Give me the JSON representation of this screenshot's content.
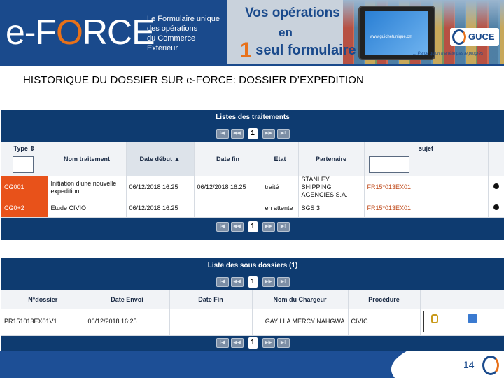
{
  "banner": {
    "logo": "e-FORCE",
    "tagline": [
      "Le Formulaire unique",
      "des opérations",
      "du Commerce Extérieur"
    ],
    "promo_line1": "Vos opérations",
    "promo_line2": "en",
    "promo_big": "1",
    "promo_line3": "seul formulaire",
    "tablet_url": "www.guichetunique.cm",
    "partner": "GUCE",
    "partner_slogan": "... Parce qu'on n'arrête pas le progrès"
  },
  "page_title": "HISTORIQUE DU DOSSIER SUR e-FORCE: DOSSIER D’EXPEDITION",
  "treatments": {
    "title": "Listes des traitements",
    "pager": {
      "first": "I◀",
      "prev": "◀◀",
      "current": "1",
      "next": "▶▶",
      "last": "▶I"
    },
    "columns": [
      "Type",
      "Nom traitement",
      "Date début",
      "Date fin",
      "Etat",
      "Partenaire",
      "sujet"
    ],
    "sort_marker": "▲",
    "type_sort_marker": "⇕",
    "rows": [
      {
        "code": "CG001",
        "name": "Initiation d'une nouvelle expedition",
        "start": "06/12/2018 16:25",
        "end": "06/12/2018 16:25",
        "state": "traité",
        "partner": "STANLEY SHIPPING AGENCIES S.A.",
        "subject": "FR15*013EX01"
      },
      {
        "code": "CG0+2",
        "name": "Etude CIVIO",
        "start": "06/12/2018 16:25",
        "end": "",
        "state": "en attente",
        "partner": "SGS 3",
        "subject": "FR15*013EX01"
      }
    ]
  },
  "sub_files": {
    "title": "Liste des sous dossiers (1)",
    "pager": {
      "first": "I◀",
      "prev": "◀◀",
      "current": "1",
      "next": "▶▶",
      "last": "▶I"
    },
    "columns": [
      "N°dossier",
      "Date Envoi",
      "Date Fin",
      "Nom du Chargeur",
      "Procédure"
    ],
    "rows": [
      {
        "file_no": "PR151013EX01V1",
        "sent": "06/12/2018 16:25",
        "end": "",
        "shipper": "GAY LLA MERCY NAHGWA",
        "procedure": "CIVIC"
      }
    ]
  },
  "footer": {
    "page_number": "14"
  },
  "colors": {
    "brand_blue": "#1a4a8c",
    "panel_navy": "#0e3b70",
    "accent_orange": "#e8521a"
  }
}
